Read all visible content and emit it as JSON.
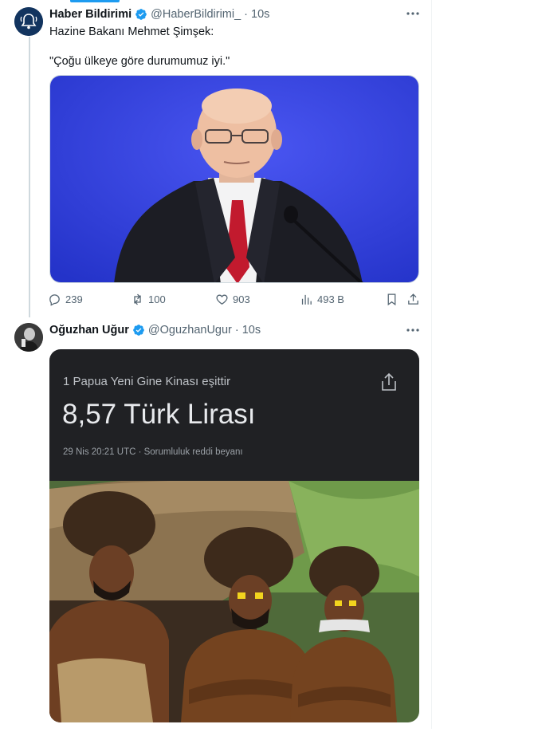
{
  "tweet1": {
    "author_name": "Haber Bildirimi",
    "handle": "@HaberBildirimi_",
    "separator": "·",
    "time": "10s",
    "text_line1": "Hazine Bakanı Mehmet Şimşek:",
    "text_line2": "\"Çoğu ülkeye göre durumumuz iyi.\"",
    "replies": "239",
    "reposts": "100",
    "likes": "903",
    "views": "493 B"
  },
  "tweet2": {
    "author_name": "Oğuzhan Uğur",
    "handle": "@OguzhanUgur",
    "separator": "·",
    "time": "10s",
    "converter": {
      "title": "1 Papua Yeni Gine Kinası eşittir",
      "value": "8,57 Türk Lirası",
      "meta": "29 Nis 20:21 UTC · Sorumluluk reddi beyanı"
    }
  },
  "colors": {
    "verified": "#1d9bf0",
    "accent": "#1d9bf0",
    "photo_background": "#2f3fe0"
  }
}
